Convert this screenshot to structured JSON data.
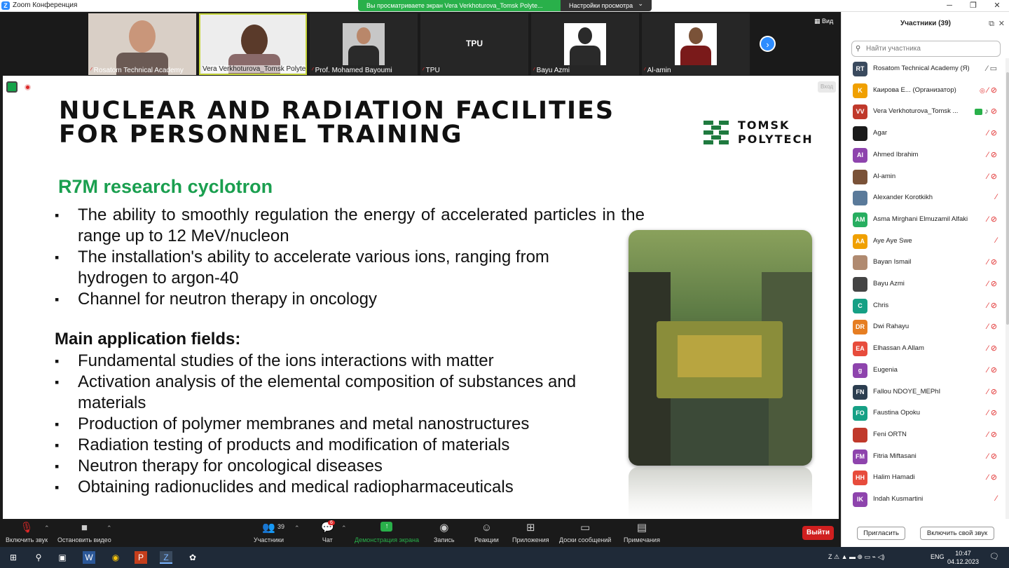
{
  "window": {
    "title": "Zoom Конференция",
    "share_banner": "Вы просматриваете экран Vera Verkhoturova_Tomsk Polyte...",
    "view_options": "Настройки просмотра"
  },
  "thumbnails": [
    {
      "name": "Rosatom Technical Academy"
    },
    {
      "name": "Vera Verkhoturova_Tomsk Polyte..."
    },
    {
      "name": "Prof. Mohamed Bayoumi"
    },
    {
      "name": "TPU",
      "text": "TPU"
    },
    {
      "name": "Bayu Azmi"
    },
    {
      "name": "Al-amin"
    }
  ],
  "view_button": "Вид",
  "slide": {
    "title_line1": "NUCLEAR AND RADIATION FACILITIES",
    "title_line2": "FOR PERSONNEL TRAINING",
    "logo_line1": "TOMSK",
    "logo_line2": "POLYTECH",
    "subheading": "R7M research cyclotron",
    "bullets": [
      "The ability to smoothly regulation the energy of accelerated particles in the range up to 12 MeV/nucleon",
      "The installation's ability to accelerate various ions, ranging from hydrogen to argon-40",
      "Channel for neutron therapy in oncology"
    ],
    "apps_heading": "Main application fields:",
    "apps": [
      "Fundamental studies of the ions interactions with matter",
      "Activation analysis of the elemental composition of substances and materials",
      "Production of polymer membranes and metal nanostructures",
      "Radiation testing of products and modification of materials",
      "Neutron therapy for oncological diseases",
      "Obtaining radionuclides and medical radiopharmaceuticals"
    ],
    "enter_label": "Вход"
  },
  "toolbar": {
    "unmute": "Включить звук",
    "stop_video": "Остановить видео",
    "participants": "Участники",
    "participants_count": "39",
    "chat": "Чат",
    "chat_badge": "6",
    "share": "Демонстрация экрана",
    "record": "Запись",
    "reactions": "Реакции",
    "apps": "Приложения",
    "whiteboards": "Доски сообщений",
    "notes": "Примечания",
    "leave": "Выйти"
  },
  "panel": {
    "title": "Участники (39)",
    "search_placeholder": "Найти участника",
    "participants": [
      {
        "initials": "RT",
        "name": "Rosatom Technical Academy (Я)",
        "color": "#3a4a5e"
      },
      {
        "initials": "K",
        "name": "Каирова Е...  (Организатор)",
        "color": "#f0a000"
      },
      {
        "initials": "VV",
        "name": "Vera Verkhoturova_Tomsk ...",
        "color": "#c0392b"
      },
      {
        "initials": "",
        "name": "Agar",
        "color": "#1a1a1a"
      },
      {
        "initials": "AI",
        "name": "Ahmed Ibrahim",
        "color": "#8e44ad"
      },
      {
        "initials": "",
        "name": "Al-amin",
        "color": "#7a5238"
      },
      {
        "initials": "",
        "name": "Alexander Korotkikh",
        "color": "#5a7a9a"
      },
      {
        "initials": "AM",
        "name": "Asma Mirghani Elmuzamil Alfaki",
        "color": "#27ae60"
      },
      {
        "initials": "AA",
        "name": "Aye Aye Swe",
        "color": "#f0a000"
      },
      {
        "initials": "",
        "name": "Bayan Ismail",
        "color": "#b08a70"
      },
      {
        "initials": "",
        "name": "Bayu Azmi",
        "color": "#444"
      },
      {
        "initials": "C",
        "name": "Chris",
        "color": "#16a085"
      },
      {
        "initials": "DR",
        "name": "Dwi Rahayu",
        "color": "#e67e22"
      },
      {
        "initials": "EA",
        "name": "Elhassan A Allam",
        "color": "#e74c3c"
      },
      {
        "initials": "g",
        "name": "Eugenia",
        "color": "#8e44ad"
      },
      {
        "initials": "FN",
        "name": "Fallou NDOYE_MEPhI",
        "color": "#2c3e50"
      },
      {
        "initials": "FO",
        "name": "Faustina  Opoku",
        "color": "#16a085"
      },
      {
        "initials": "",
        "name": "Feni ORTN",
        "color": "#c0392b"
      },
      {
        "initials": "FM",
        "name": "Fitria Miftasani",
        "color": "#8e44ad"
      },
      {
        "initials": "HH",
        "name": "Halim Hamadi",
        "color": "#e74c3c"
      },
      {
        "initials": "IK",
        "name": "Indah Kusmartini",
        "color": "#8e44ad"
      }
    ],
    "invite": "Пригласить",
    "unmute_self": "Включить свой звук"
  },
  "taskbar": {
    "lang": "ENG",
    "time": "10:47",
    "date": "04.12.2023"
  }
}
